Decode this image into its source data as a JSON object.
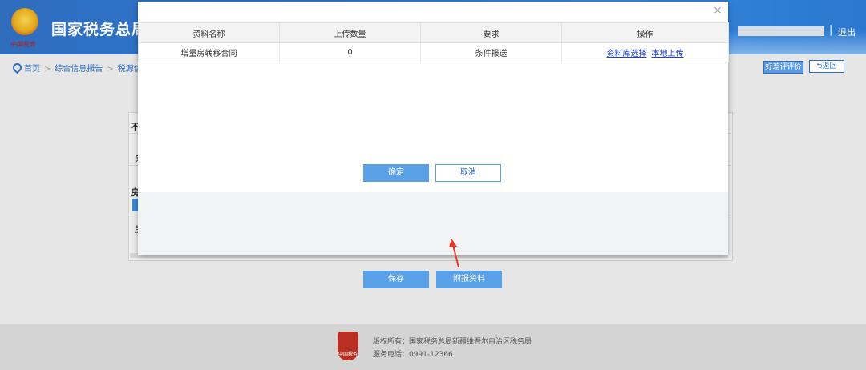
{
  "header": {
    "title": "国家税务总局",
    "emblem_caption": "中国税务",
    "logout": "退出",
    "separator": "|"
  },
  "breadcrumb": {
    "items": [
      "首页",
      "综合信息报告",
      "税源信息报"
    ]
  },
  "toolbar": {
    "rate_label": "好差评评价",
    "back_label": "返回"
  },
  "background_form": {
    "label_1": "不",
    "label_2": "房",
    "row_char_1": "来",
    "row_char_2": "房",
    "save_label": "保存",
    "attach_label": "附报资料"
  },
  "modal": {
    "close_symbol": "×",
    "columns": [
      "资料名称",
      "上传数量",
      "要求",
      "操作"
    ],
    "rows": [
      {
        "name": "增量房转移合同",
        "count": "0",
        "requirement": "条件报送",
        "action_library": "资料库选择",
        "action_upload": "本地上传"
      }
    ],
    "ok_label": "确定",
    "cancel_label": "取消"
  },
  "footer": {
    "copyright": "版权所有：国家税务总局新疆维吾尔自治区税务局",
    "phone": "服务电话：0991-12366",
    "logo_text": "中国税务"
  },
  "colors": {
    "header_blue": "#2d78d4",
    "button_blue": "#5aa0e6",
    "link_blue": "#1d3fe0",
    "arrow_red": "#e8392b"
  }
}
